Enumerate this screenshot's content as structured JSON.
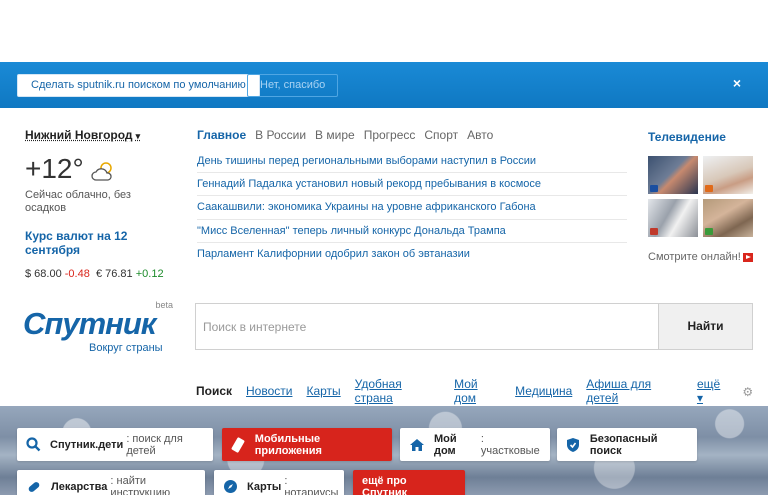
{
  "banner": {
    "primary_label": "Сделать sputnik.ru поиском по умолчанию",
    "secondary_label": "Нет, спасибо",
    "close_label": "×"
  },
  "weather": {
    "city": "Нижний Новгород",
    "temperature": "+12°",
    "description": "Сейчас облачно, без осадков"
  },
  "rates": {
    "title": "Курс валют на 12 сентября",
    "usd": "$ 68.00",
    "usd_change": "-0.48",
    "eur": "€ 76.81",
    "eur_change": "+0.12"
  },
  "news": {
    "tabs": [
      {
        "label": "Главное"
      },
      {
        "label": "В России"
      },
      {
        "label": "В мире"
      },
      {
        "label": "Прогресс"
      },
      {
        "label": "Спорт"
      },
      {
        "label": "Авто"
      }
    ],
    "items": [
      {
        "title": "День тишины перед региональными выборами наступил в России"
      },
      {
        "title": "Геннадий Падалка установил новый рекорд пребывания в космосе"
      },
      {
        "title": "Саакашвили: экономика Украины на уровне африканского Габона"
      },
      {
        "title": "\"Мисс Вселенная\" теперь личный конкурс Дональда Трампа"
      },
      {
        "title": "Парламент Калифорнии одобрил закон об эвтаназии"
      }
    ]
  },
  "tv": {
    "title": "Телевидение",
    "watch_label": "Смотрите онлайн!"
  },
  "logo": {
    "beta": "beta",
    "name": "Спутник",
    "tagline": "Вокруг страны"
  },
  "search": {
    "placeholder": "Поиск в интернете",
    "button_label": "Найти"
  },
  "nav": {
    "items": [
      {
        "label": "Поиск"
      },
      {
        "label": "Новости"
      },
      {
        "label": "Карты"
      },
      {
        "label": "Удобная страна"
      },
      {
        "label": "Мой дом"
      },
      {
        "label": "Медицина"
      },
      {
        "label": "Афиша для детей"
      }
    ],
    "more_label": "ещё"
  },
  "tiles": [
    {
      "bold": "Спутник.дети",
      "text": ": поиск для детей"
    },
    {
      "bold": "Мобильные приложения",
      "text": ""
    },
    {
      "bold": "Мой дом",
      "text": ": участковые"
    },
    {
      "bold": "Безопасный поиск",
      "text": ""
    },
    {
      "bold": "Лекарства",
      "text": ": найти инструкцию"
    },
    {
      "bold": "Карты",
      "text": ": нотариусы"
    },
    {
      "bold": "ещё про Спутник",
      "text": ""
    }
  ],
  "colors": {
    "accent_blue": "#1565a8",
    "banner_blue": "#1a8ad6",
    "red": "#d7241c"
  }
}
